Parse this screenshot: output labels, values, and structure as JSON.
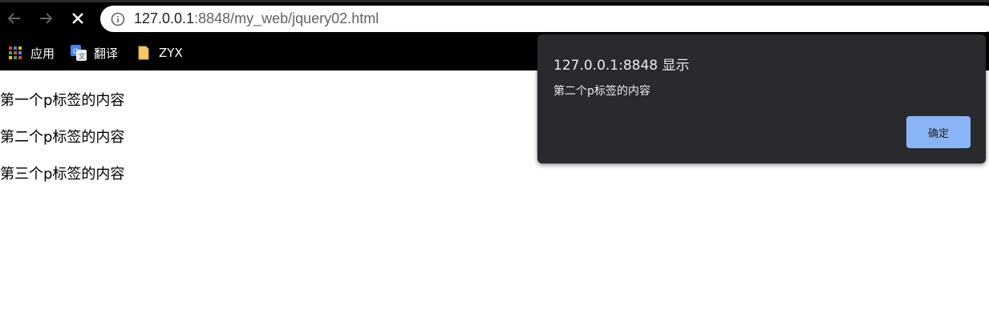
{
  "browser": {
    "url_host": "127.0.0.1",
    "url_rest": ":8848/my_web/jquery02.html",
    "icons": [
      "back-arrow-icon",
      "forward-arrow-icon",
      "stop-loading-icon",
      "site-info-icon"
    ]
  },
  "bookmarks": [
    {
      "label": "应用",
      "icon": "apps-grid-icon"
    },
    {
      "label": "翻译",
      "icon": "google-translate-icon"
    },
    {
      "label": "ZYX",
      "icon": "folder-icon"
    }
  ],
  "page": {
    "paragraphs": [
      "第一个p标签的内容",
      "第二个p标签的内容",
      "第三个p标签的内容"
    ]
  },
  "alert": {
    "title": "127.0.0.1:8848 显示",
    "message": "第二个p标签的内容",
    "ok_label": "确定"
  },
  "colors": {
    "toolbar_bg": "#000000",
    "dialog_bg": "#292a2d",
    "dialog_text": "#e8eaed",
    "ok_button": "#8ab4f8"
  }
}
